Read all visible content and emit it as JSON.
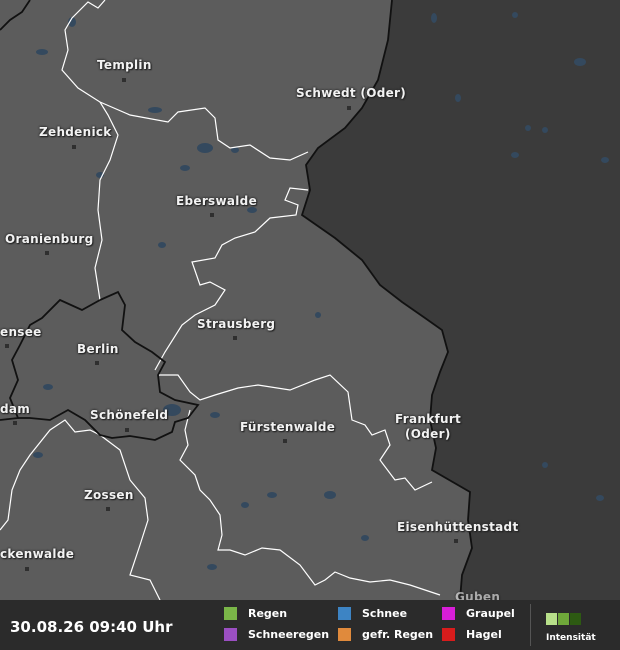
{
  "map": {
    "cities": [
      {
        "name": "Templin"
      },
      {
        "name": "Schwedt (Oder)"
      },
      {
        "name": "Zehdenick"
      },
      {
        "name": "Eberswalde"
      },
      {
        "name": "Oranienburg"
      },
      {
        "name": "ensee"
      },
      {
        "name": "Berlin"
      },
      {
        "name": "Strausberg"
      },
      {
        "name": "dam"
      },
      {
        "name": "Schönefeld"
      },
      {
        "name": "Fürstenwalde"
      },
      {
        "name": "Frankfurt"
      },
      {
        "name": "(Oder)"
      },
      {
        "name": "Zossen"
      },
      {
        "name": "Eisenhüttenstadt"
      },
      {
        "name": "ckenwalde"
      },
      {
        "name": "Guben"
      }
    ],
    "colors": {
      "germany": "#5c5c5c",
      "poland": "#3b3b3b",
      "water": "#34495e",
      "border": "#111111",
      "district": "#ffffff"
    }
  },
  "footer": {
    "timestamp": "30.08.26 09:40 Uhr",
    "legend": {
      "regen": {
        "label": "Regen",
        "color": "#7ab648"
      },
      "schneeregen": {
        "label": "Schneeregen",
        "color": "#9b4fc2"
      },
      "schnee": {
        "label": "Schnee",
        "color": "#3d84c4"
      },
      "gefr_regen": {
        "label": "gefr. Regen",
        "color": "#e08a3c"
      },
      "graupel": {
        "label": "Graupel",
        "color": "#d81ed8"
      },
      "hagel": {
        "label": "Hagel",
        "color": "#d81c1c"
      }
    },
    "intensity": {
      "label": "Intensität",
      "colors": [
        "#b8e08a",
        "#6fa83a",
        "#2d5a12"
      ]
    }
  }
}
